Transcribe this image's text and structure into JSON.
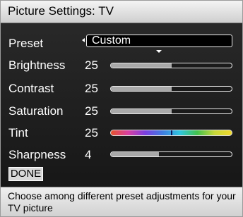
{
  "header": {
    "title": "Picture Settings: TV"
  },
  "settings": {
    "preset": {
      "label": "Preset",
      "value": "Custom"
    },
    "brightness": {
      "label": "Brightness",
      "value": "25",
      "level_percent": 50
    },
    "contrast": {
      "label": "Contrast",
      "value": "25",
      "level_percent": 50
    },
    "saturation": {
      "label": "Saturation",
      "value": "25",
      "level_percent": 50
    },
    "tint": {
      "label": "Tint",
      "value": "25",
      "level_percent": 50
    },
    "sharpness": {
      "label": "Sharpness",
      "value": "4",
      "level_percent": 40
    }
  },
  "actions": {
    "done_label": "DONE"
  },
  "help": {
    "text": "Choose among different preset adjustments for your TV picture"
  },
  "colors": {
    "title_bar": "#e6e6e6",
    "panel_background": "#1e1e1e",
    "slider_fill": "#a9a9a9",
    "tint_gradient": [
      "#e5532c",
      "#d83fa1",
      "#7a3fe0",
      "#3f7de0",
      "#2fc6e0",
      "#43c24d",
      "#c8d93a",
      "#f0d92c"
    ]
  }
}
